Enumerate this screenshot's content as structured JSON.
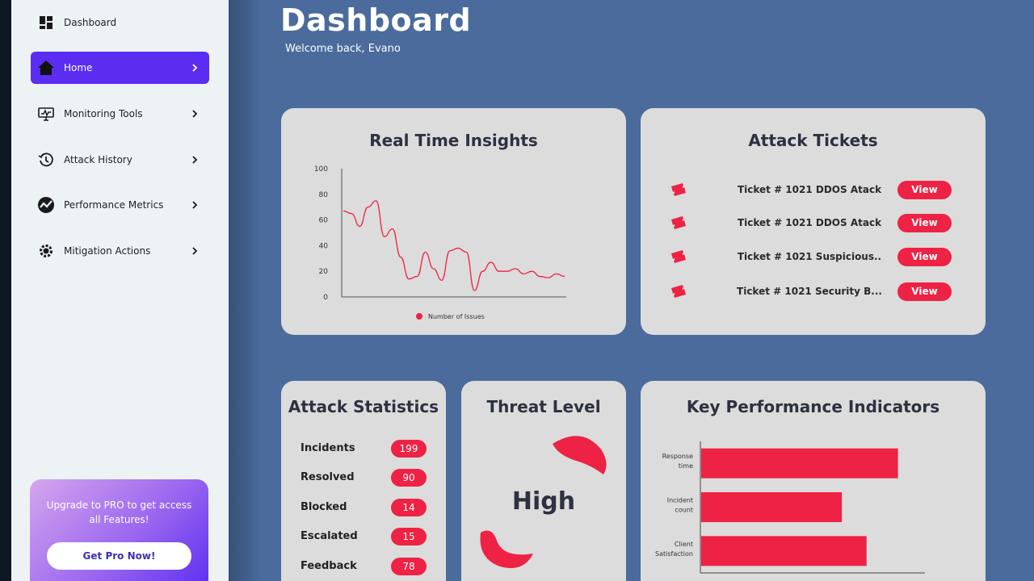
{
  "sidebar": {
    "items": [
      {
        "label": "Dashboard",
        "icon": "dashboard-grid-icon"
      },
      {
        "label": "Home",
        "icon": "home-icon"
      },
      {
        "label": "Monitoring Tools",
        "icon": "monitor-icon"
      },
      {
        "label": "Attack History",
        "icon": "history-icon"
      },
      {
        "label": "Performance Metrics",
        "icon": "performance-icon"
      },
      {
        "label": "Mitigation Actions",
        "icon": "gear-shield-icon"
      }
    ],
    "active_index": 1,
    "active_color": "#5b2df0",
    "promo": {
      "text": "Upgrade to  PRO to get access all Features!",
      "button": "Get Pro Now!"
    }
  },
  "header": {
    "title": "Dashboard",
    "welcome": "Welcome back, Evano"
  },
  "insights": {
    "title": "Real Time Insights"
  },
  "tickets": {
    "title": "Attack Tickets",
    "items": [
      {
        "label": "Ticket # 1021 DDOS Atack",
        "action": "View"
      },
      {
        "label": "Ticket # 1021 DDOS Atack",
        "action": "View"
      },
      {
        "label": "Ticket # 1021 Suspicious..",
        "action": "View"
      },
      {
        "label": "Ticket # 1021 Security B...",
        "action": "View"
      }
    ],
    "accent_color": "#ee2244"
  },
  "stats": {
    "title": "Attack Statistics",
    "items": [
      {
        "label": "Incidents",
        "value": "199"
      },
      {
        "label": "Resolved",
        "value": "90"
      },
      {
        "label": "Blocked",
        "value": "14"
      },
      {
        "label": "Escalated",
        "value": "15"
      },
      {
        "label": "Feedback",
        "value": "78"
      }
    ]
  },
  "threat": {
    "title": "Threat Level",
    "value": "High",
    "color": "#ee2244"
  },
  "kpi": {
    "title": "Key Performance Indicators"
  },
  "chart_data": [
    {
      "type": "line",
      "title": "Real Time Insights",
      "ylim": [
        0,
        100
      ],
      "yticks": [
        "0",
        "20",
        "40",
        "60",
        "80",
        "100"
      ],
      "legend": "bottom",
      "series": [
        {
          "name": "Number of Issues",
          "color": "#ee2244",
          "x": [
            0,
            1,
            2,
            3,
            4,
            5,
            6,
            7,
            8,
            9,
            10,
            11,
            12,
            13,
            14,
            15,
            16,
            17,
            18,
            19,
            20,
            21,
            22,
            23,
            24,
            25,
            26,
            27
          ],
          "values": [
            67,
            65,
            55,
            70,
            75,
            47,
            53,
            31,
            14,
            16,
            35,
            22,
            13,
            36,
            38,
            35,
            5,
            20,
            27,
            20,
            20,
            22,
            18,
            20,
            16,
            15,
            18,
            16
          ]
        }
      ]
    },
    {
      "type": "bar",
      "orientation": "horizontal",
      "title": "Key Performance Indicators",
      "categories": [
        "Response time",
        "Incident count",
        "Client Satisfaction"
      ],
      "values": [
        88,
        63,
        74
      ],
      "xlim": [
        0,
        100
      ],
      "color": "#ee2244"
    }
  ]
}
